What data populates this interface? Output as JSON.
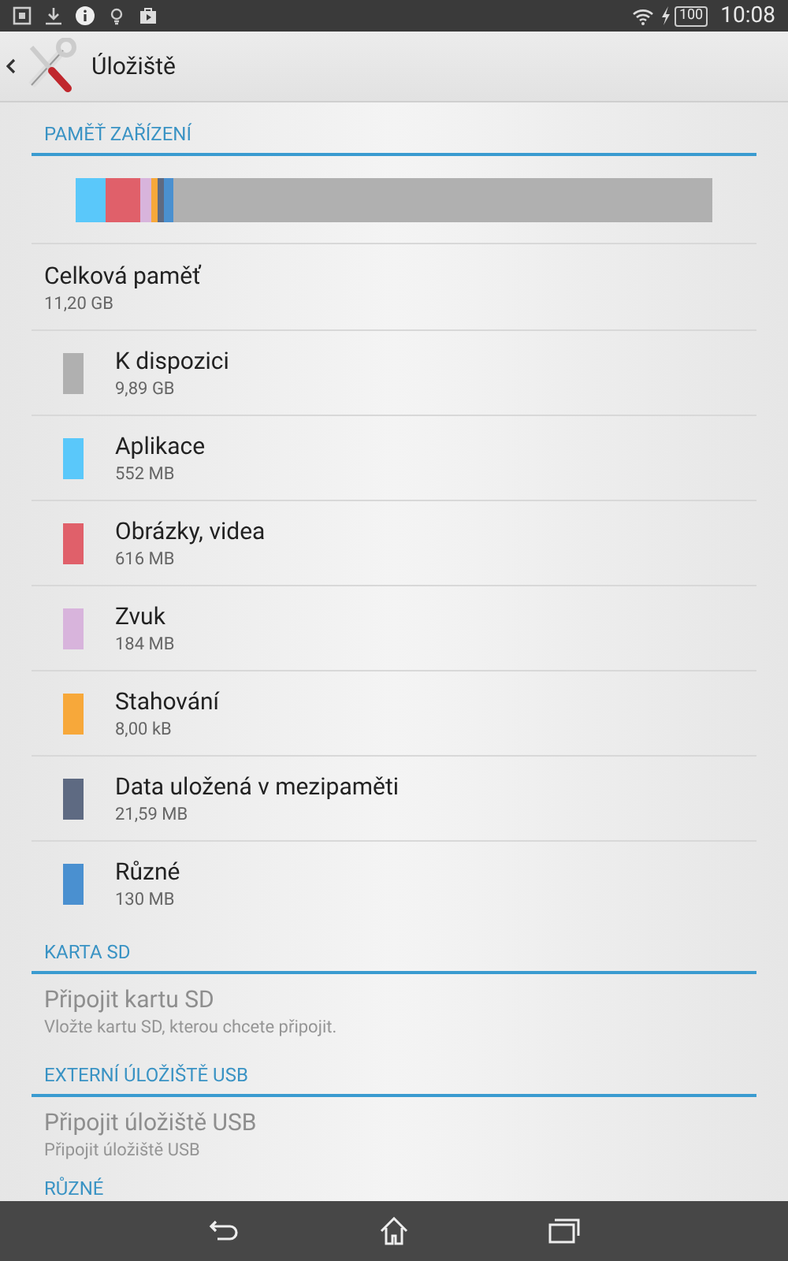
{
  "status_bar": {
    "time": "10:08",
    "battery": "100"
  },
  "action_bar": {
    "title": "Úložiště"
  },
  "device_section": {
    "header": "PAMĚŤ ZAŘÍZENÍ",
    "total": {
      "label": "Celková paměť",
      "value": "11,20 GB"
    },
    "items": [
      {
        "label": "K dispozici",
        "value": "9,89 GB",
        "color": "#b0b0b0"
      },
      {
        "label": "Aplikace",
        "value": "552 MB",
        "color": "#5ac8fa"
      },
      {
        "label": "Obrázky, videa",
        "value": "616 MB",
        "color": "#e0606a"
      },
      {
        "label": "Zvuk",
        "value": "184 MB",
        "color": "#d8b4dc"
      },
      {
        "label": "Stahování",
        "value": "8,00 kB",
        "color": "#f7a83a"
      },
      {
        "label": "Data uložená v mezipaměti",
        "value": "21,59 MB",
        "color": "#5e6a82"
      },
      {
        "label": "Různé",
        "value": "130 MB",
        "color": "#4a90d0"
      }
    ]
  },
  "sd_section": {
    "header": "KARTA SD",
    "item": {
      "label": "Připojit kartu SD",
      "value": "Vložte kartu SD, kterou chcete připojit.",
      "disabled": true
    }
  },
  "usb_section": {
    "header": "EXTERNÍ ÚLOŽIŠTĚ USB",
    "item": {
      "label": "Připojit úložiště USB",
      "value": "Připojit úložiště USB",
      "disabled": true
    }
  },
  "misc_section": {
    "header": "RŮZNÉ"
  }
}
